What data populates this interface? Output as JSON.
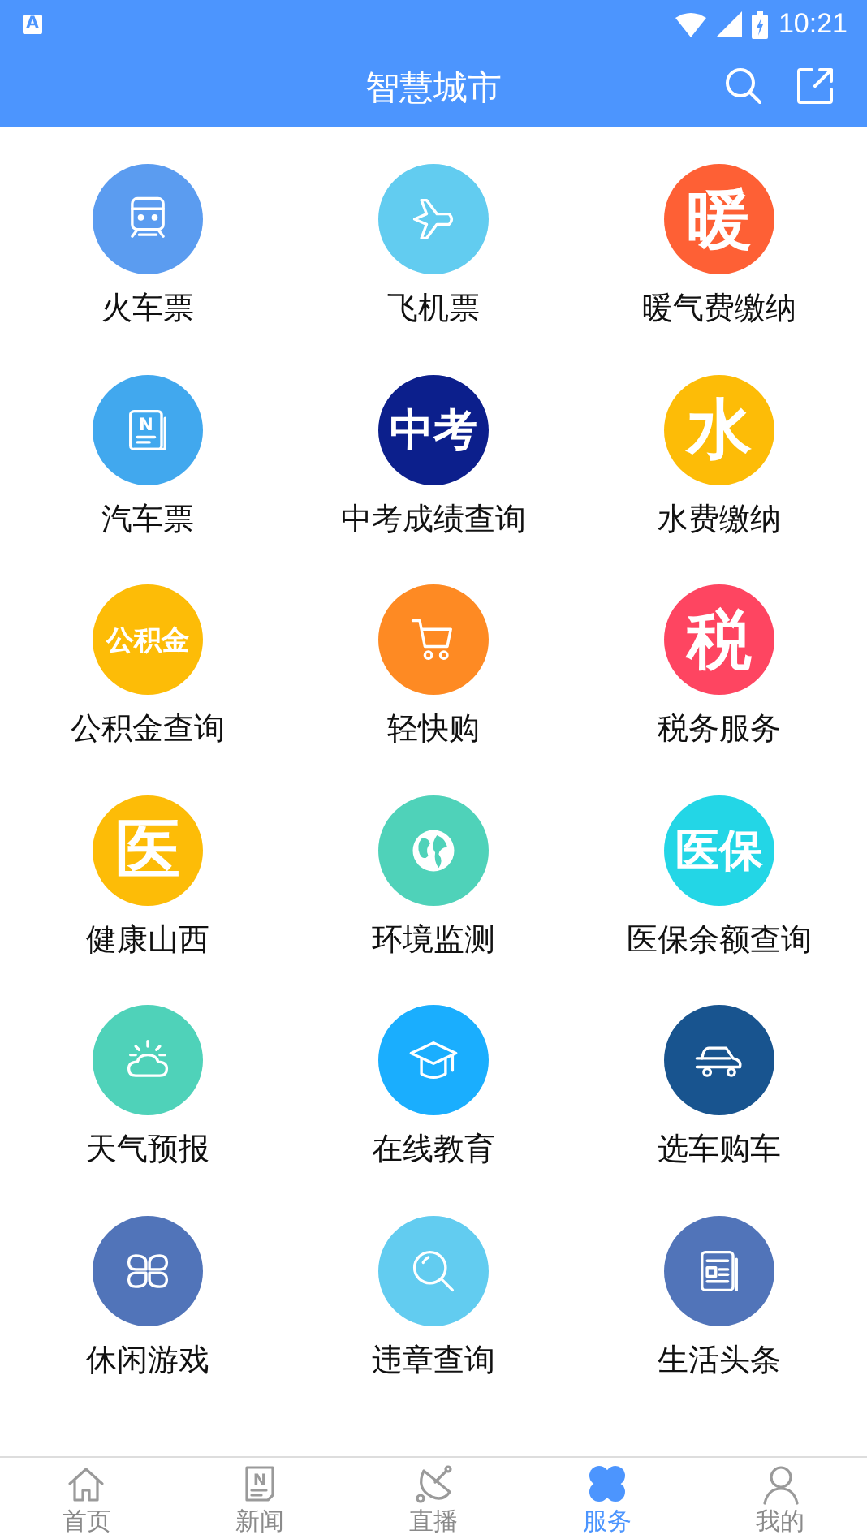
{
  "status_bar": {
    "app_badge": "A",
    "time": "10:21"
  },
  "app_bar": {
    "title": "智慧城市"
  },
  "services": [
    {
      "label": "火车票",
      "color": "#5b9cf0",
      "kind": "train"
    },
    {
      "label": "飞机票",
      "color": "#62ccf0",
      "kind": "plane"
    },
    {
      "label": "暖气费缴纳",
      "color": "#fe6035",
      "kind": "text",
      "icon_text": "暖"
    },
    {
      "label": "汽车票",
      "color": "#41a8ee",
      "kind": "news",
      "icon_text": "N"
    },
    {
      "label": "中考成绩查询",
      "color": "#0c1f8c",
      "kind": "text",
      "icon_text": "中考"
    },
    {
      "label": "水费缴纳",
      "color": "#fdbc07",
      "kind": "text",
      "icon_text": "水"
    },
    {
      "label": "公积金查询",
      "color": "#fdbc07",
      "kind": "text",
      "icon_text": "公积金"
    },
    {
      "label": "轻快购",
      "color": "#fe8a23",
      "kind": "cart"
    },
    {
      "label": "税务服务",
      "color": "#fe4561",
      "kind": "text",
      "icon_text": "税"
    },
    {
      "label": "健康山西",
      "color": "#fdbc07",
      "kind": "text",
      "icon_text": "医"
    },
    {
      "label": "环境监测",
      "color": "#4fd2b9",
      "kind": "globe"
    },
    {
      "label": "医保余额查询",
      "color": "#23d6e6",
      "kind": "text",
      "icon_text": "医保"
    },
    {
      "label": "天气预报",
      "color": "#4fd2b9",
      "kind": "weather"
    },
    {
      "label": "在线教育",
      "color": "#1aaefe",
      "kind": "cap"
    },
    {
      "label": "选车购车",
      "color": "#18548f",
      "kind": "car"
    },
    {
      "label": "休闲游戏",
      "color": "#5174b9",
      "kind": "clover"
    },
    {
      "label": "违章查询",
      "color": "#62ccf0",
      "kind": "search"
    },
    {
      "label": "生活头条",
      "color": "#5174b9",
      "kind": "paper"
    }
  ],
  "tabs": [
    {
      "label": "首页",
      "kind": "home",
      "selected": false
    },
    {
      "label": "新闻",
      "kind": "news",
      "icon_text": "N",
      "selected": false
    },
    {
      "label": "直播",
      "kind": "dish",
      "selected": false
    },
    {
      "label": "服务",
      "kind": "clover",
      "selected": true
    },
    {
      "label": "我的",
      "kind": "person",
      "selected": false
    }
  ]
}
